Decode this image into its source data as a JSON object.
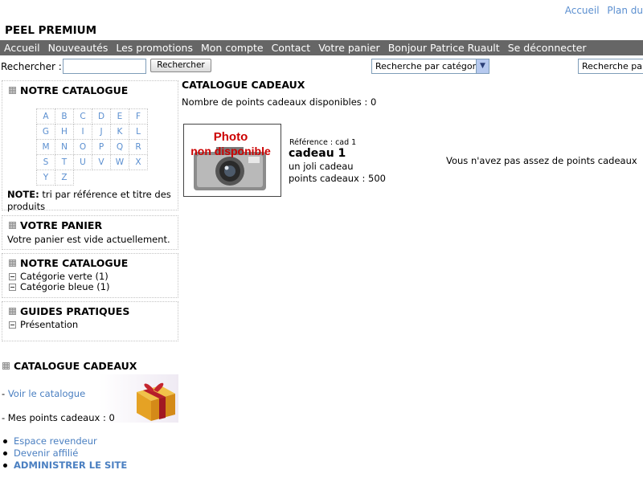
{
  "top_links": [
    "Accueil",
    "Plan du"
  ],
  "site_title": "PEEL PREMIUM",
  "nav": [
    "Accueil",
    "Nouveautés",
    "Les promotions",
    "Mon compte",
    "Contact",
    "Votre panier",
    "Bonjour Patrice Ruault",
    "Se déconnecter"
  ],
  "search": {
    "label": "Rechercher :",
    "value": "",
    "button": "Rechercher",
    "category_select": "Recherche par catégorie",
    "second_select": "Recherche par m"
  },
  "catalog_box": {
    "title": "NOTRE CATALOGUE",
    "letters": [
      [
        "A",
        "B",
        "C",
        "D",
        "E",
        "F"
      ],
      [
        "G",
        "H",
        "I",
        "J",
        "K",
        "L"
      ],
      [
        "M",
        "N",
        "O",
        "P",
        "Q",
        "R"
      ],
      [
        "S",
        "T",
        "U",
        "V",
        "W",
        "X"
      ],
      [
        "Y",
        "Z"
      ]
    ],
    "note_label": "NOTE:",
    "note_text": " tri par référence et titre des produits"
  },
  "cart_box": {
    "title": "VOTRE PANIER",
    "text": "Votre panier est vide actuellement."
  },
  "categories_box": {
    "title": "NOTRE CATALOGUE",
    "items": [
      "Catégorie verte (1)",
      "Catégorie bleue (1)"
    ]
  },
  "guides_box": {
    "title": "GUIDES PRATIQUES",
    "items": [
      "Présentation"
    ]
  },
  "gift_box": {
    "title": "CATALOGUE CADEAUX",
    "link_prefix": "- ",
    "link": "Voir le catalogue",
    "points_text": "- Mes points cadeaux : 0"
  },
  "bottom_links": [
    "Espace revendeur",
    "Devenir affilié",
    "ADMINISTRER LE SITE"
  ],
  "main": {
    "title": "CATALOGUE CADEAUX",
    "points_available": "Nombre de points cadeaux disponibles : 0",
    "product": {
      "image_text_1": "Photo",
      "image_text_2": "non disponible",
      "reference": "Référence : cad 1",
      "name": "cadeau 1",
      "description": "un joli cadeau",
      "points": "points cadeaux : 500"
    },
    "insufficient": "Vous n'avez pas assez de points cadeaux"
  },
  "colors": {
    "nav_bg": "#666666",
    "link": "#4a7fc1",
    "photo_text": "#cc0000"
  }
}
